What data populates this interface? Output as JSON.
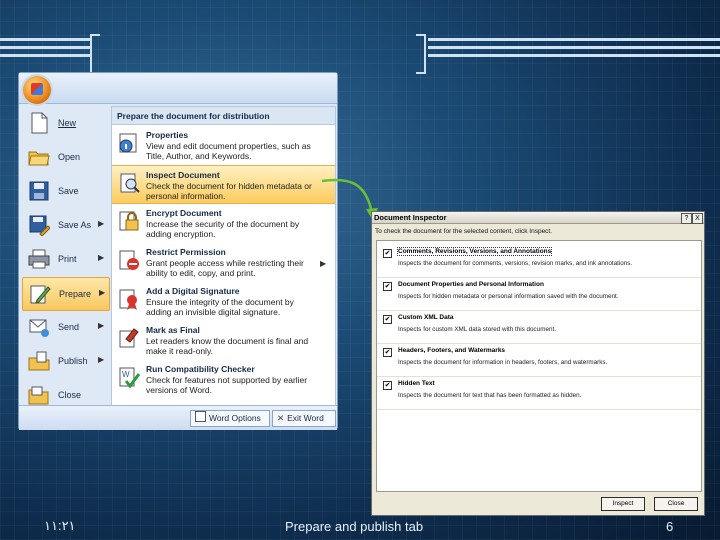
{
  "office_menu": {
    "left_items": [
      {
        "label": "New"
      },
      {
        "label": "Open"
      },
      {
        "label": "Save"
      },
      {
        "label": "Save As"
      },
      {
        "label": "Print"
      },
      {
        "label": "Prepare"
      },
      {
        "label": "Send"
      },
      {
        "label": "Publish"
      },
      {
        "label": "Close"
      }
    ],
    "submenu_header": "Prepare the document for distribution",
    "submenu_items": [
      {
        "title": "Properties",
        "desc": "View and edit document properties, such as Title, Author, and Keywords."
      },
      {
        "title": "Inspect Document",
        "desc": "Check the document for hidden metadata or personal information."
      },
      {
        "title": "Encrypt Document",
        "desc": "Increase the security of the document by adding encryption."
      },
      {
        "title": "Restrict Permission",
        "desc": "Grant people access while restricting their ability to edit, copy, and print."
      },
      {
        "title": "Add a Digital Signature",
        "desc": "Ensure the integrity of the document by adding an invisible digital signature."
      },
      {
        "title": "Mark as Final",
        "desc": "Let readers know the document is final and make it read-only."
      },
      {
        "title": "Run Compatibility Checker",
        "desc": "Check for features not supported by earlier versions of Word."
      }
    ],
    "word_options_label": "Word Options",
    "exit_word_label": "Exit Word"
  },
  "document_inspector": {
    "title": "Document Inspector",
    "help_glyph": "?",
    "close_glyph": "X",
    "intro": "To check the document for the selected content, click Inspect.",
    "checkmark": "✔",
    "items": [
      {
        "name": "Comments, Revisions, Versions, and Annotations",
        "desc": "Inspects the document for comments, versions, revision marks, and ink annotations.",
        "checked": true
      },
      {
        "name": "Document Properties and Personal Information",
        "desc": "Inspects for hidden metadata or personal information saved with the document.",
        "checked": true
      },
      {
        "name": "Custom XML Data",
        "desc": "Inspects for custom XML data stored with this document.",
        "checked": true
      },
      {
        "name": "Headers, Footers, and Watermarks",
        "desc": "Inspects the document for information in headers, footers, and watermarks.",
        "checked": true
      },
      {
        "name": "Hidden Text",
        "desc": "Inspects the document for text that has been formatted as hidden.",
        "checked": true
      }
    ],
    "inspect_label": "Inspect",
    "close_label": "Close"
  },
  "footer": {
    "time": "١١:٢١",
    "caption": "Prepare and publish tab",
    "page_number": "6"
  },
  "colors": {
    "slide_bg": "#1b4b75",
    "menu_highlight": "#f8c760",
    "connector": "#6abf3a"
  }
}
